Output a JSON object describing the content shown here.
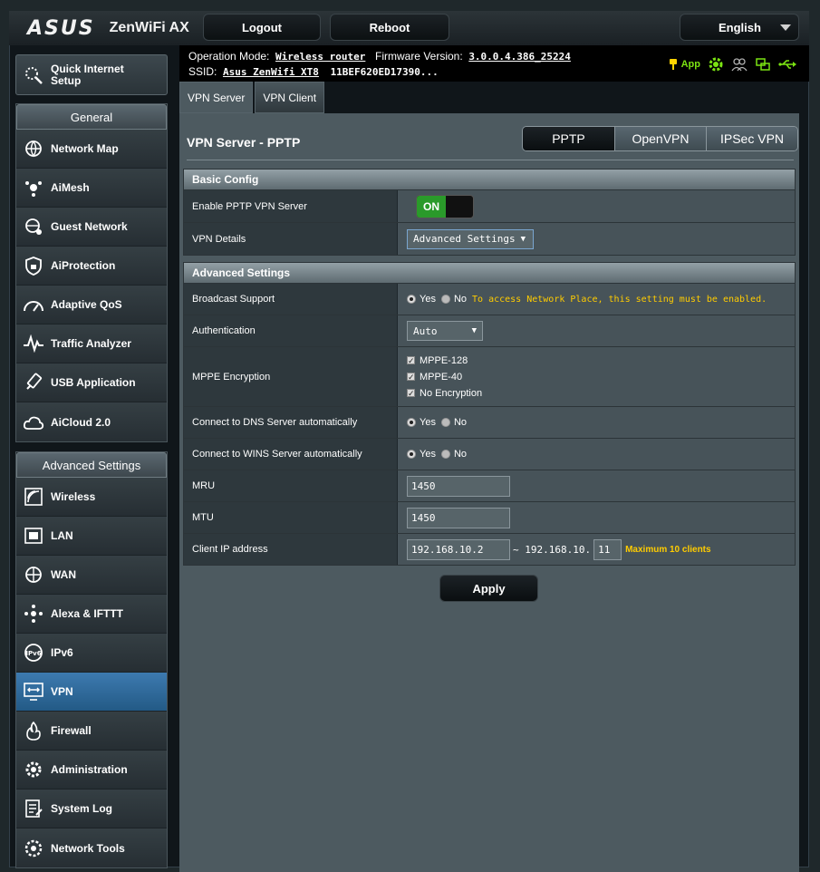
{
  "header": {
    "brand": "ASUS",
    "model": "ZenWiFi AX",
    "logout_label": "Logout",
    "reboot_label": "Reboot",
    "language": "English"
  },
  "info": {
    "op_mode_label": "Operation Mode:",
    "op_mode_value": "Wireless router",
    "fw_label": "Firmware Version:",
    "fw_value": "3.0.0.4.386_25224",
    "ssid_label": "SSID:",
    "ssid_value": "Asus ZenWifi XT8",
    "ssid_extra": "11BEF620ED17390...",
    "app_label": "App"
  },
  "sidebar": {
    "quick_setup": "Quick Internet Setup",
    "general_title": "General",
    "general": [
      "Network Map",
      "AiMesh",
      "Guest Network",
      "AiProtection",
      "Adaptive QoS",
      "Traffic Analyzer",
      "USB Application",
      "AiCloud 2.0"
    ],
    "advanced_title": "Advanced Settings",
    "advanced": [
      "Wireless",
      "LAN",
      "WAN",
      "Alexa & IFTTT",
      "IPv6",
      "VPN",
      "Firewall",
      "Administration",
      "System Log",
      "Network Tools"
    ]
  },
  "tabs": [
    "VPN Server",
    "VPN Client"
  ],
  "main": {
    "title": "VPN Server - PPTP",
    "protocols": [
      "PPTP",
      "OpenVPN",
      "IPSec VPN"
    ],
    "basic_config": "Basic Config",
    "enable_label": "Enable PPTP VPN Server",
    "toggle_on": "ON",
    "vpn_details_label": "VPN Details",
    "vpn_details_value": "Advanced Settings",
    "advanced_title": "Advanced Settings",
    "broadcast_label": "Broadcast Support",
    "yes": "Yes",
    "no": "No",
    "broadcast_hint": "To access Network Place, this setting must be enabled.",
    "auth_label": "Authentication",
    "auth_value": "Auto",
    "mppe_label": "MPPE Encryption",
    "mppe_opts": [
      "MPPE-128",
      "MPPE-40",
      "No Encryption"
    ],
    "dns_label": "Connect to DNS Server automatically",
    "wins_label": "Connect to WINS Server automatically",
    "mru_label": "MRU",
    "mru_value": "1450",
    "mtu_label": "MTU",
    "mtu_value": "1450",
    "client_ip_label": "Client IP address",
    "client_ip_start": "192.168.10.2",
    "client_ip_sep": "~ 192.168.10.",
    "client_ip_end": "11",
    "max_clients": "Maximum 10 clients",
    "apply_label": "Apply"
  },
  "colors": {
    "accent_green": "#7be312",
    "hint_yellow": "#ffcc00",
    "active_blue": "#2f6ea0"
  }
}
